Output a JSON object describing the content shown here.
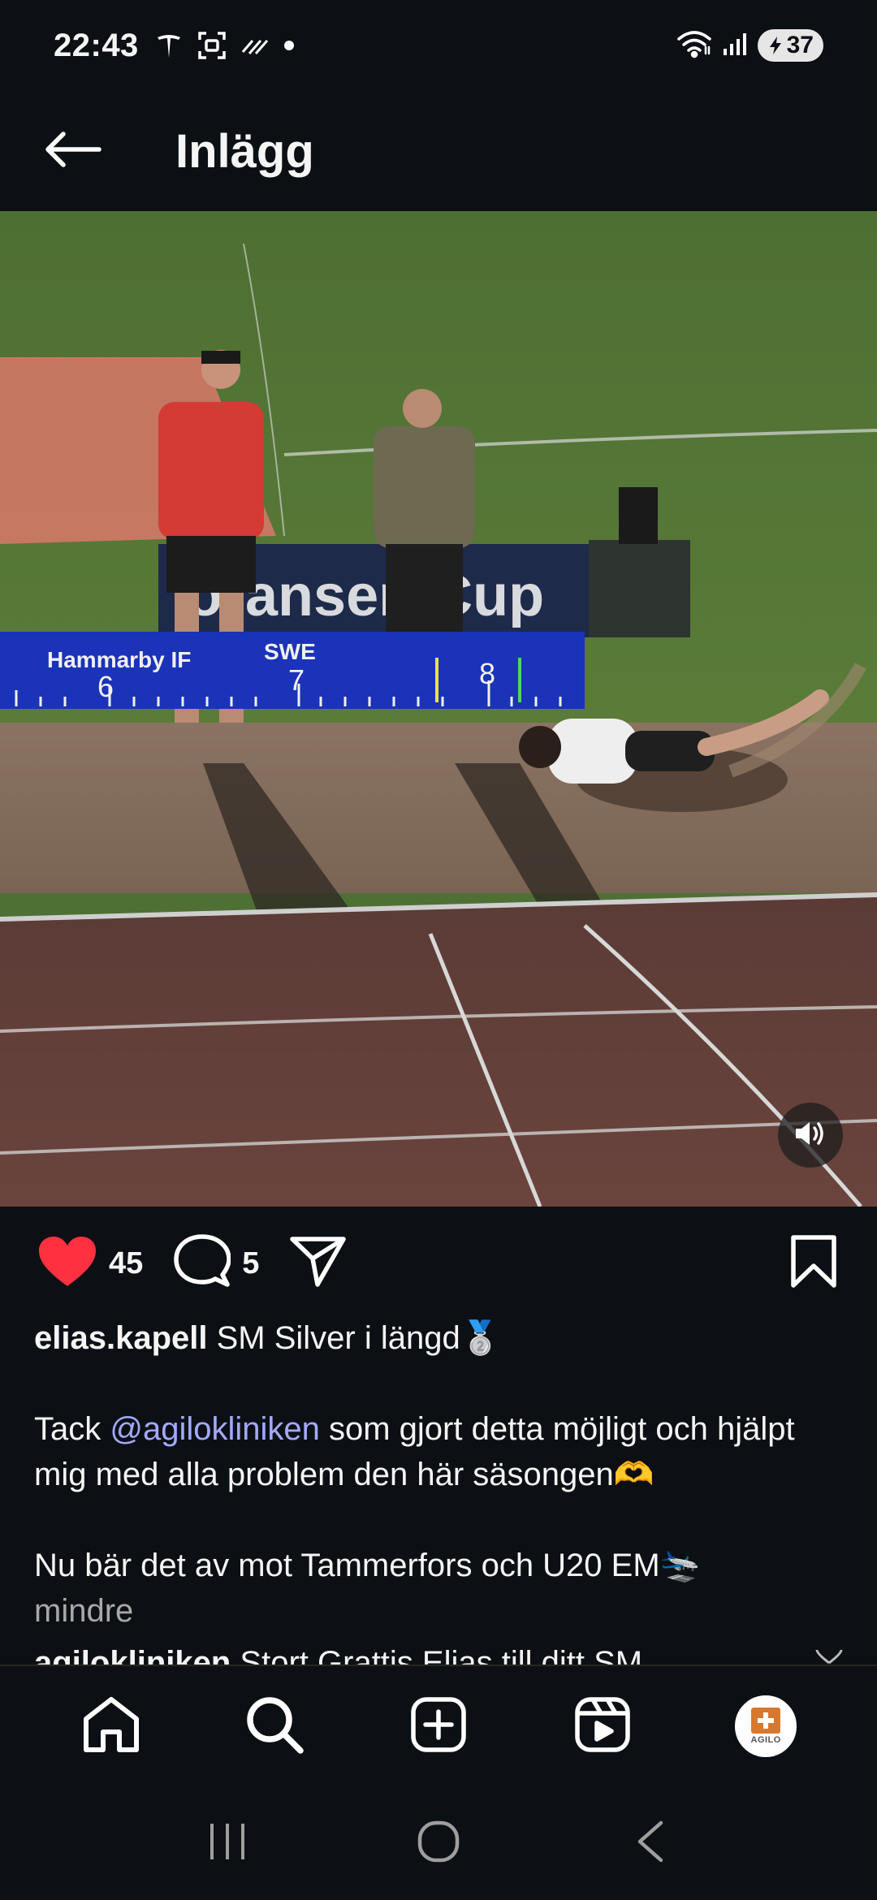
{
  "status_bar": {
    "time": "22:43",
    "left_icons": [
      "tesla-icon",
      "screenshot-icon",
      "nfc-icon",
      "dot-icon"
    ],
    "right_icons": [
      "wifi-icon",
      "signal-icon"
    ],
    "battery_level": "37"
  },
  "header": {
    "back_icon": "arrow-left-icon",
    "title": "Inlägg"
  },
  "media": {
    "scoreboard": {
      "club": "Hammarby IF",
      "country": "SWE",
      "ticks": [
        "6",
        "7",
        "8"
      ]
    },
    "banner_text": "oransen Cup",
    "sound_icon": "speaker-on-icon"
  },
  "actions": {
    "likes_count": "45",
    "comments_count": "5",
    "liked": true,
    "like_color": "#ff3040"
  },
  "caption": {
    "username": "elias.kapell",
    "line1": "SM Silver i längd🥈",
    "line2_before": "Tack ",
    "mention": "@agilokliniken",
    "line2_after": " som gjort detta möjligt och hjälpt mig med alla problem den här säsongen🫶",
    "line3": "Nu bär det av mot Tammerfors och U20 EM🛬",
    "less_label": "mindre"
  },
  "comment_peek": {
    "username": "agilokliniken",
    "text": "Stort Grattis Elias till ditt SM"
  },
  "bottom_nav": {
    "items": [
      "home-icon",
      "search-icon",
      "create-icon",
      "reels-icon",
      "profile-avatar"
    ],
    "avatar_text": "AGILO"
  },
  "system_nav": [
    "recents-button",
    "home-button",
    "back-button"
  ],
  "colors": {
    "background": "#0c1014",
    "mention": "#a3a9ff",
    "like": "#ff3040"
  }
}
